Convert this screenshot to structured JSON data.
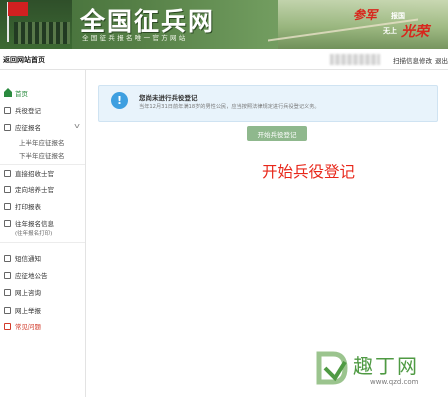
{
  "banner": {
    "title": "全国征兵网",
    "subtitle": "全国征兵报名唯一官方网站",
    "slogan_1": "参军",
    "slogan_2": "报国",
    "slogan_3": "无上",
    "slogan_4": "光荣"
  },
  "topbar": {
    "home": "返回网站首页",
    "link_password": "扫描信息修改",
    "link_logout": "退出"
  },
  "sidebar": {
    "items": [
      {
        "label": "首页",
        "icon": "home-icon"
      },
      {
        "label": "兵役登记",
        "icon": "form-icon"
      },
      {
        "label": "应征报名",
        "icon": "form-icon"
      },
      {
        "label": "直接招收士官",
        "icon": "form-icon"
      },
      {
        "label": "定向培养士官",
        "icon": "form-icon"
      },
      {
        "label": "打印报表",
        "icon": "print-icon"
      },
      {
        "label": "往年报名信息",
        "icon": "history-icon"
      },
      {
        "label": "短信通知",
        "icon": "message-icon"
      },
      {
        "label": "应征地公告",
        "icon": "notice-icon"
      },
      {
        "label": "网上咨询",
        "icon": "consult-icon"
      },
      {
        "label": "网上举报",
        "icon": "report-icon"
      },
      {
        "label": "常见问题",
        "icon": "faq-icon"
      }
    ],
    "subitems": [
      "上半年应征报名",
      "下半年应征报名"
    ],
    "history_note": "(往年报名打印)"
  },
  "notice": {
    "title": "您尚未进行兵役登记",
    "text": "当年12月31日前年满18岁的男性公民，应当按照法律规定进行兵役登记义务。"
  },
  "start_button": "开始兵役登记",
  "big_title": "开始兵役登记",
  "watermark": {
    "name": "趣丁网",
    "url": "www.qzd.com"
  },
  "colors": {
    "accent_green": "#2a8a3e",
    "button_green": "#8fb88d",
    "title_red": "#e8271a",
    "info_blue": "#3e9fe0"
  }
}
